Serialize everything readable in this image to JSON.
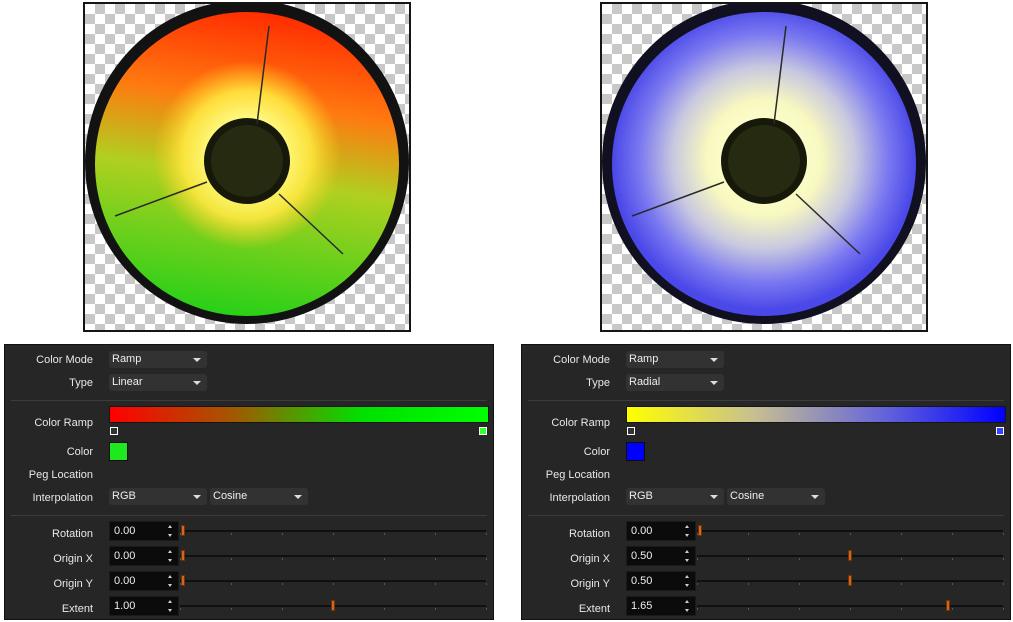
{
  "previews": [
    {
      "name": "linear-ramp-preview"
    },
    {
      "name": "radial-ramp-preview"
    }
  ],
  "panels": [
    {
      "color_mode_label": "Color Mode",
      "color_mode_value": "Ramp",
      "type_label": "Type",
      "type_value": "Linear",
      "color_ramp_label": "Color Ramp",
      "ramp_colors": [
        "#ff0000",
        "#a05a00",
        "#00e000",
        "#00ff00"
      ],
      "stop_left_color": "#333333",
      "stop_right_color": "#33ff33",
      "color_label": "Color",
      "color_value": "#1ee81e",
      "peg_location_label": "Peg Location",
      "interpolation_label": "Interpolation",
      "interpolation_value": "RGB",
      "interpolation_curve": "Cosine",
      "rotation_label": "Rotation",
      "rotation_value": "0.00",
      "rotation_level": 0.0,
      "origin_x_label": "Origin X",
      "origin_x_value": "0.00",
      "origin_x_level": 0.0,
      "origin_y_label": "Origin Y",
      "origin_y_value": "0.00",
      "origin_y_level": 0.0,
      "extent_label": "Extent",
      "extent_value": "1.00",
      "extent_level": 0.5
    },
    {
      "color_mode_label": "Color Mode",
      "color_mode_value": "Ramp",
      "type_label": "Type",
      "type_value": "Radial",
      "color_ramp_label": "Color Ramp",
      "ramp_colors": [
        "#ffff00",
        "#c8c090",
        "#6868d8",
        "#0000ff"
      ],
      "stop_left_color": "#333333",
      "stop_right_color": "#3344ff",
      "color_label": "Color",
      "color_value": "#0000ff",
      "peg_location_label": "Peg Location",
      "interpolation_label": "Interpolation",
      "interpolation_value": "RGB",
      "interpolation_curve": "Cosine",
      "rotation_label": "Rotation",
      "rotation_value": "0.00",
      "rotation_level": 0.0,
      "origin_x_label": "Origin X",
      "origin_x_value": "0.50",
      "origin_x_level": 0.5,
      "origin_y_label": "Origin Y",
      "origin_y_value": "0.50",
      "origin_y_level": 0.5,
      "extent_label": "Extent",
      "extent_value": "1.65",
      "extent_level": 0.825
    }
  ]
}
